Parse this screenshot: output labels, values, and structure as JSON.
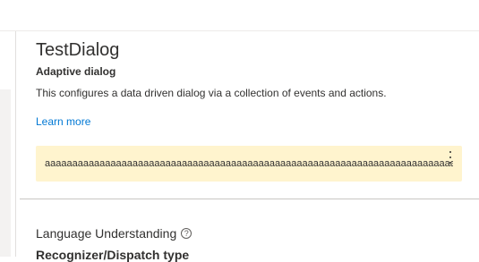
{
  "dialog": {
    "title": "TestDialog",
    "subtitle": "Adaptive dialog",
    "description": "This configures a data driven dialog via a collection of events and actions.",
    "learn_more_label": "Learn more"
  },
  "warning": {
    "text": "aaaaaaaaaaaaaaaaaaaaaaaaaaaaaaaaaaaaaaaaaaaaaaaaaaaaaaaaaaaaaaaaaaaaaaaaaaaaaaaaaaaaaa",
    "more_icon": "more-vertical-icon"
  },
  "language_understanding": {
    "label": "Language Understanding",
    "help_icon": "help-circle-icon",
    "recognizer_label": "Recognizer/Dispatch type"
  },
  "colors": {
    "accent": "#0078d4",
    "warning_bg": "#fff4ce",
    "text": "#323130",
    "divider": "#c8c6c4"
  }
}
